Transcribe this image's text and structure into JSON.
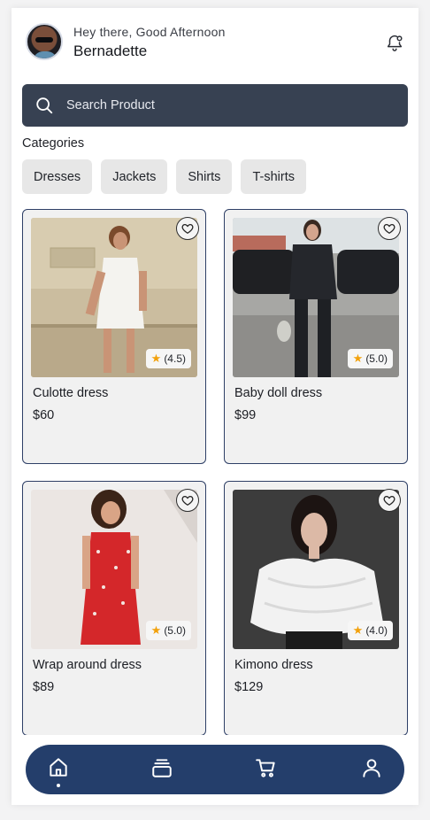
{
  "header": {
    "greeting": "Hey there, Good Afternoon",
    "user_name": "Bernadette"
  },
  "search": {
    "placeholder": "Search Product",
    "icon": "search-icon"
  },
  "categories": {
    "title": "Categories",
    "items": [
      "Dresses",
      "Jackets",
      "Shirts",
      "T-shirts"
    ]
  },
  "products": [
    {
      "name": "Culotte dress",
      "price": "$60",
      "rating": "(4.5)"
    },
    {
      "name": "Baby doll dress",
      "price": "$99",
      "rating": "(5.0)"
    },
    {
      "name": "Wrap around dress",
      "price": "$89",
      "rating": "(5.0)"
    },
    {
      "name": "Kimono dress",
      "price": "$129",
      "rating": "(4.0)"
    }
  ],
  "bottom_nav": {
    "items": [
      "home-icon",
      "collections-icon",
      "cart-icon",
      "profile-icon"
    ],
    "active": "home-icon"
  },
  "colors": {
    "search_bg": "#374152",
    "nav_bg": "#243e6b",
    "card_border": "#2e3f66",
    "star": "#f2a10c"
  }
}
